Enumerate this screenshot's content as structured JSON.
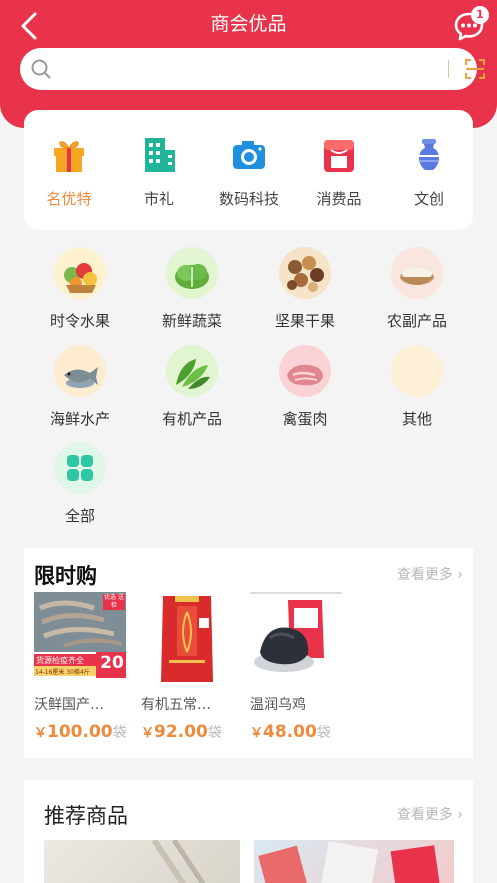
{
  "header": {
    "title": "商会优品",
    "message_badge": "1"
  },
  "search": {
    "placeholder": "",
    "value": ""
  },
  "categories": [
    {
      "label": "名优特",
      "icon": "gift-icon",
      "active": true
    },
    {
      "label": "市礼",
      "icon": "building-icon",
      "active": false
    },
    {
      "label": "数码科技",
      "icon": "camera-icon",
      "active": false
    },
    {
      "label": "消费品",
      "icon": "shop-icon",
      "active": false
    },
    {
      "label": "文创",
      "icon": "vase-icon",
      "active": false
    }
  ],
  "subcategories": [
    {
      "label": "时令水果",
      "icon": "fruit-basket-icon"
    },
    {
      "label": "新鲜蔬菜",
      "icon": "lettuce-icon"
    },
    {
      "label": "坚果干果",
      "icon": "nuts-icon"
    },
    {
      "label": "农副产品",
      "icon": "rice-bowl-icon"
    },
    {
      "label": "海鲜水产",
      "icon": "fish-icon"
    },
    {
      "label": "有机产品",
      "icon": "greens-icon"
    },
    {
      "label": "禽蛋肉",
      "icon": "meat-icon"
    },
    {
      "label": "其他",
      "icon": "other-icon"
    },
    {
      "label": "全部",
      "icon": "all-grid-icon"
    }
  ],
  "flash_sale": {
    "title": "限时购",
    "more": "查看更多 ›",
    "products": [
      {
        "name": "沃鲜国产…",
        "currency": "￥",
        "price": "100.00",
        "unit": "袋",
        "tag": "20",
        "banner_top": "货源检疫齐全",
        "banner_sub": "14-16厘米 30條4斤",
        "corner": "优选 送检"
      },
      {
        "name": "有机五常…",
        "currency": "￥",
        "price": "92.00",
        "unit": "袋"
      },
      {
        "name": "温润乌鸡",
        "currency": "￥",
        "price": "48.00",
        "unit": "袋"
      }
    ]
  },
  "recommended": {
    "title": "推荐商品",
    "more": "查看更多 ›"
  },
  "colors": {
    "brand": "#e8334a",
    "accent": "#f08a3c"
  }
}
